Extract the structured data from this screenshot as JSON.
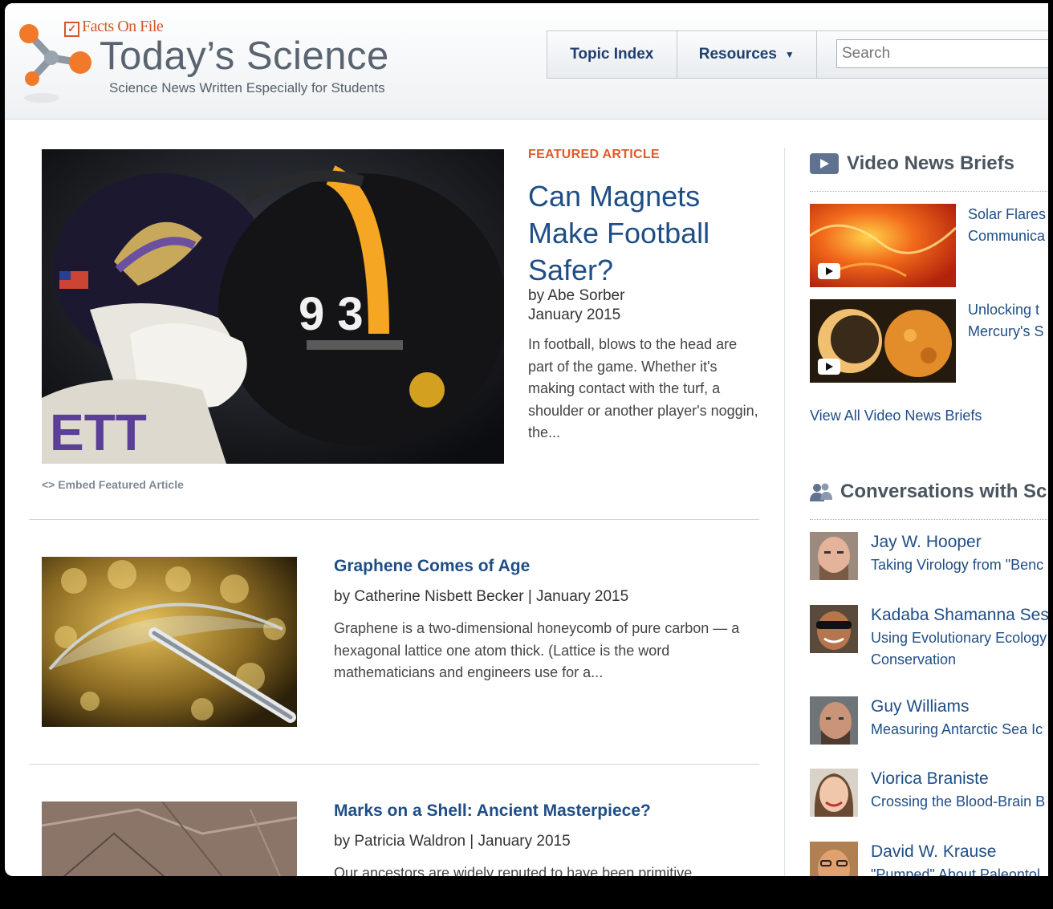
{
  "header": {
    "brand": "Facts On File",
    "site_title": "Today’s Science",
    "tagline": "Science News Written Especially for Students",
    "nav": {
      "topic_index": "Topic Index",
      "resources": "Resources",
      "search_placeholder": "Search"
    }
  },
  "featured": {
    "label": "FEATURED ARTICLE",
    "title": "Can Magnets Make Football Safer?",
    "author": "by Abe Sorber",
    "date": "January 2015",
    "summary": "In football, blows to the head are part of the game. Whether it's making contact with the turf, a shoulder or another player's noggin, the...",
    "embed_label": "<> Embed Featured Article"
  },
  "articles": [
    {
      "title": "Graphene Comes of Age",
      "byline": "by Catherine Nisbett Becker | January 2015",
      "summary": "Graphene is a two-dimensional honeycomb of pure carbon — a hexagonal lattice one atom thick. (Lattice is the word mathematicians and engineers use for a..."
    },
    {
      "title": "Marks on a Shell: Ancient Masterpiece?",
      "byline": "by Patricia Waldron | January 2015",
      "summary": "Our ancestors are widely reputed to have been primitive"
    }
  ],
  "video_briefs": {
    "heading": "Video News Briefs",
    "items": [
      {
        "line1": "Solar Flares",
        "line2": "Communica"
      },
      {
        "line1": "Unlocking t",
        "line2": "Mercury's S"
      }
    ],
    "view_all": "View All Video News Briefs"
  },
  "conversations": {
    "heading": "Conversations with Sc",
    "items": [
      {
        "name": "Jay W. Hooper",
        "topic": "Taking Virology from \"Benc",
        "topic2": ""
      },
      {
        "name": "Kadaba Shamanna Ses",
        "topic": "Using Evolutionary Ecology",
        "topic2": "Conservation"
      },
      {
        "name": "Guy Williams",
        "topic": "Measuring Antarctic Sea Ic",
        "topic2": ""
      },
      {
        "name": "Viorica Braniste",
        "topic": "Crossing the Blood-Brain B",
        "topic2": ""
      },
      {
        "name": "David W. Krause",
        "topic": "\"Pumped\" About Paleontol",
        "topic2": ""
      }
    ]
  },
  "colors": {
    "accent_orange": "#e05a2b",
    "link_blue": "#1f4e86",
    "icon_slate": "#5f7390"
  },
  "icons": [
    "molecule-logo-icon",
    "checkbox-icon",
    "caret-down-icon",
    "play-icon",
    "people-icon"
  ]
}
